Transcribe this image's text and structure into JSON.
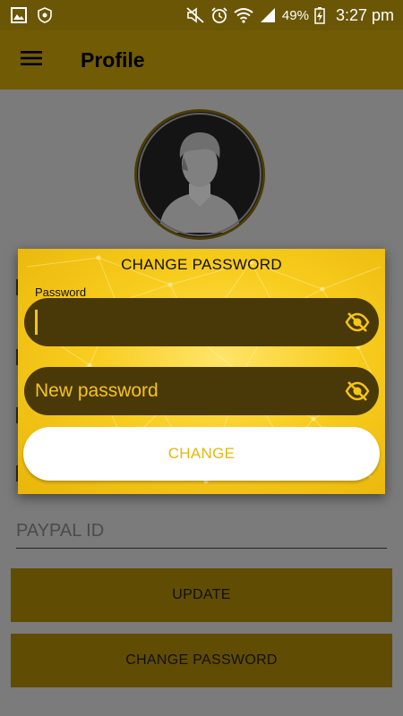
{
  "statusbar": {
    "battery": "49%",
    "time": "3:27 pm",
    "icons": [
      "gallery-icon",
      "shield-icon",
      "mute-icon",
      "alarm-icon",
      "wifi-icon",
      "signal-icon",
      "battery-charging-icon"
    ]
  },
  "appbar": {
    "title": "Profile",
    "menu_icon": "hamburger-menu-icon"
  },
  "background": {
    "paypal_placeholder": "PAYPAL ID",
    "update_button": "UPDATE",
    "change_password_button": "CHANGE PASSWORD"
  },
  "dialog": {
    "title": "CHANGE PASSWORD",
    "password_label": "Password",
    "password_value": "",
    "new_password_placeholder": "New password",
    "change_button": "CHANGE",
    "visibility_icon": "eye-off-icon"
  },
  "colors": {
    "statusbar": "#6b5606",
    "appbar": "#715b05",
    "accent": "#f5c518",
    "field_bg": "#4a3908",
    "dim_button": "#614c04"
  }
}
